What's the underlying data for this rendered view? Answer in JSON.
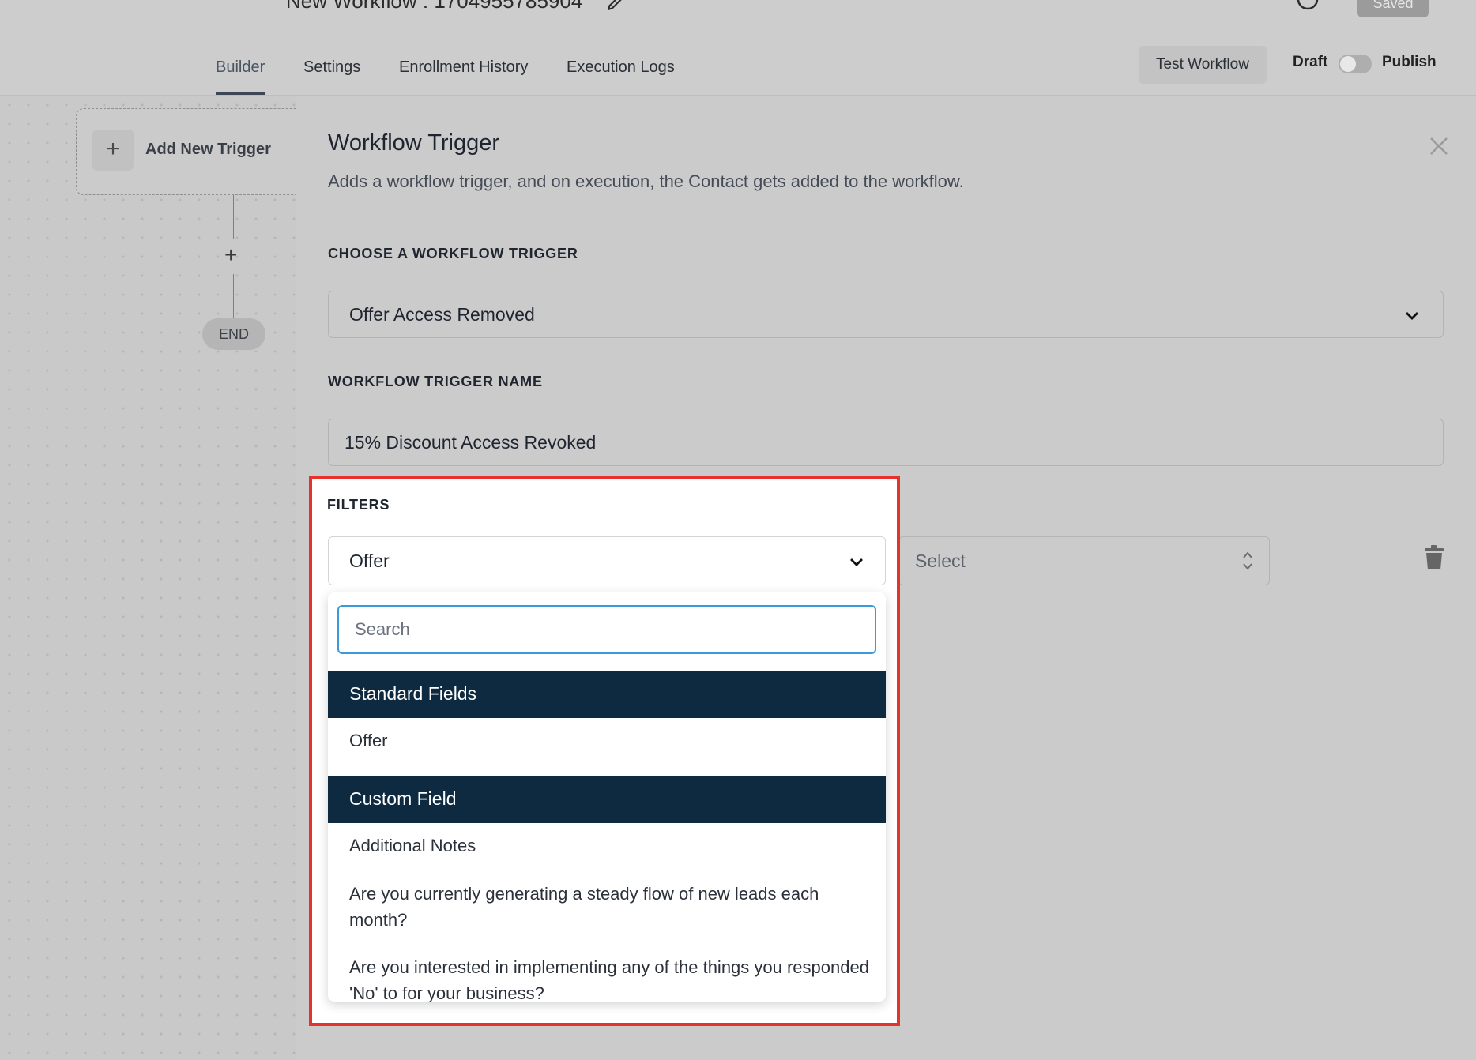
{
  "topbar": {
    "workflow_title": "New Workflow : 1704955785904",
    "saved_label": "Saved",
    "icons": [
      "edit-icon",
      "help-icon"
    ]
  },
  "tabs": {
    "items": [
      {
        "label": "Builder",
        "active": true
      },
      {
        "label": "Settings",
        "active": false
      },
      {
        "label": "Enrollment History",
        "active": false
      },
      {
        "label": "Execution Logs",
        "active": false
      }
    ],
    "test_workflow_label": "Test Workflow",
    "draft_label": "Draft",
    "publish_label": "Publish",
    "publish_on": false
  },
  "canvas": {
    "add_trigger_label": "Add New Trigger",
    "add_trigger_icon": "+",
    "add_step_icon": "+",
    "end_label": "END"
  },
  "panel": {
    "title": "Workflow Trigger",
    "description": "Adds a workflow trigger, and on execution, the Contact gets added to the workflow.",
    "choose_trigger_label": "CHOOSE A WORKFLOW TRIGGER",
    "trigger_value": "Offer Access Removed",
    "trigger_name_label": "WORKFLOW TRIGGER NAME",
    "trigger_name_value": "15% Discount Access Revoked",
    "filters_label": "FILTERS",
    "filter_field_value": "Offer",
    "filter_operator_placeholder": "Select"
  },
  "dropdown": {
    "search_placeholder": "Search",
    "groups": [
      {
        "header": "Standard Fields",
        "options": [
          "Offer"
        ]
      },
      {
        "header": "Custom Field",
        "options": [
          "Additional Notes",
          "Are you currently generating a steady flow of new leads each month?",
          "Are you interested in implementing any of the things you responded 'No' to for your business?"
        ]
      }
    ]
  },
  "colors": {
    "group_header_bg": "#0d2a40",
    "highlight_border": "#e8312a",
    "search_focus": "#3b9ad9"
  }
}
